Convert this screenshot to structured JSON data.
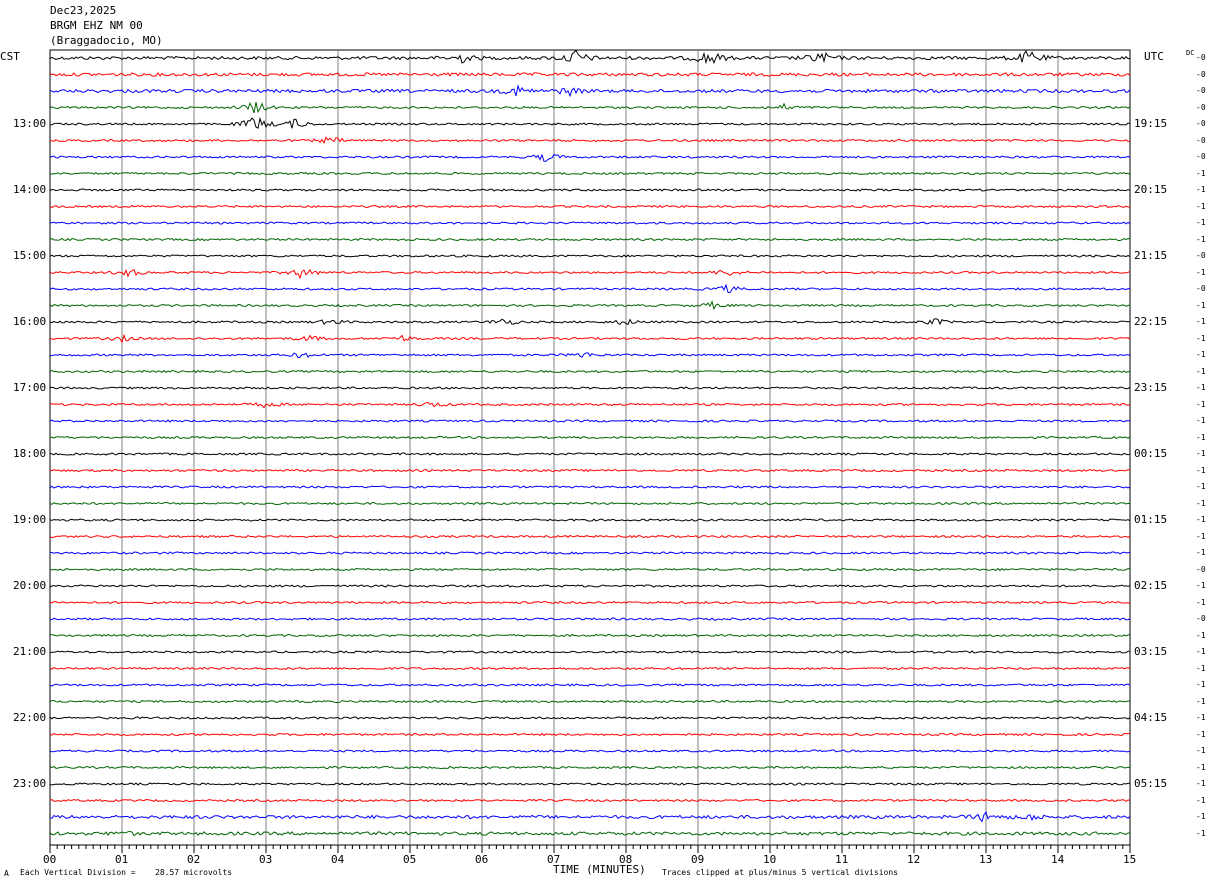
{
  "header": {
    "date": "Dec23,2025",
    "station": "BRGM EHZ NM 00",
    "location": "(Braggadocio, MO)"
  },
  "left_tz": "CST",
  "right_tz": "UTC",
  "dc_label": "DC",
  "chart_data": {
    "type": "line",
    "title": "",
    "xlabel": "TIME (MINUTES)",
    "xlim": [
      0,
      15
    ],
    "x_ticks": [
      "00",
      "01",
      "02",
      "03",
      "04",
      "05",
      "06",
      "07",
      "08",
      "09",
      "10",
      "11",
      "12",
      "13",
      "14",
      "15"
    ],
    "trace_minutes": 15,
    "trace_count": 48,
    "trace_colors": [
      "#000000",
      "#ff0000",
      "#0000ff",
      "#006400"
    ],
    "left_hour_labels": [
      "13:00",
      "14:00",
      "15:00",
      "16:00",
      "17:00",
      "18:00",
      "19:00",
      "20:00",
      "21:00",
      "22:00",
      "23:00"
    ],
    "right_hour_labels": [
      "19:15",
      "20:15",
      "21:15",
      "22:15",
      "23:15",
      "00:15",
      "01:15",
      "02:15",
      "03:15",
      "04:15",
      "05:15"
    ],
    "dc_offsets": [
      "-0",
      "-0",
      "-0",
      "-0",
      "-0",
      "-0",
      "-0",
      "-1",
      "-1",
      "-1",
      "-1",
      "-1",
      "-0",
      "-1",
      "-0",
      "-1",
      "-1",
      "-1",
      "-1",
      "-1",
      "-1",
      "-1",
      "-1",
      "-1",
      "-1",
      "-1",
      "-1",
      "-1",
      "-1",
      "-1",
      "-1",
      "-0",
      "-1",
      "-1",
      "-0",
      "-1",
      "-1",
      "-1",
      "-1",
      "-1",
      "-1",
      "-1",
      "-1",
      "-1",
      "-1",
      "-1",
      "-1",
      "-1"
    ],
    "events": [
      {
        "trace": 0,
        "minute": 5.7,
        "amp": 5
      },
      {
        "trace": 0,
        "minute": 7.3,
        "amp": 8
      },
      {
        "trace": 0,
        "minute": 9.15,
        "amp": 8
      },
      {
        "trace": 0,
        "minute": 10.7,
        "amp": 7
      },
      {
        "trace": 0,
        "minute": 13.6,
        "amp": 8
      },
      {
        "trace": 2,
        "minute": 6.5,
        "amp": 5
      },
      {
        "trace": 2,
        "minute": 7.2,
        "amp": 4
      },
      {
        "trace": 3,
        "minute": 2.85,
        "amp": 7
      },
      {
        "trace": 3,
        "minute": 10.2,
        "amp": 3
      },
      {
        "trace": 4,
        "minute": 2.85,
        "amp": 9
      },
      {
        "trace": 4,
        "minute": 3.4,
        "amp": 5
      },
      {
        "trace": 5,
        "minute": 3.9,
        "amp": 4
      },
      {
        "trace": 6,
        "minute": 6.9,
        "amp": 5
      },
      {
        "trace": 13,
        "minute": 1.1,
        "amp": 4
      },
      {
        "trace": 13,
        "minute": 3.5,
        "amp": 6
      },
      {
        "trace": 13,
        "minute": 9.4,
        "amp": 4
      },
      {
        "trace": 14,
        "minute": 9.4,
        "amp": 4
      },
      {
        "trace": 15,
        "minute": 9.2,
        "amp": 3
      },
      {
        "trace": 16,
        "minute": 3.9,
        "amp": 3
      },
      {
        "trace": 16,
        "minute": 6.3,
        "amp": 4
      },
      {
        "trace": 16,
        "minute": 8.0,
        "amp": 3
      },
      {
        "trace": 16,
        "minute": 12.3,
        "amp": 3
      },
      {
        "trace": 17,
        "minute": 1.0,
        "amp": 3
      },
      {
        "trace": 17,
        "minute": 3.6,
        "amp": 3
      },
      {
        "trace": 17,
        "minute": 4.9,
        "amp": 3
      },
      {
        "trace": 18,
        "minute": 3.5,
        "amp": 3
      },
      {
        "trace": 18,
        "minute": 7.4,
        "amp": 3
      },
      {
        "trace": 21,
        "minute": 3.0,
        "amp": 3
      },
      {
        "trace": 21,
        "minute": 5.3,
        "amp": 3
      },
      {
        "trace": 46,
        "minute": 13.0,
        "amp": 5
      },
      {
        "trace": 46,
        "minute": 13.6,
        "amp": 3
      },
      {
        "trace": 47,
        "minute": 1.0,
        "amp": 2
      }
    ]
  },
  "footer": {
    "scale_label": "Each Vertical Division =",
    "scale_value": "28.57 microvolts",
    "clip_note": "Traces clipped at plus/minus 5 vertical divisions",
    "corner_mark": "A"
  }
}
